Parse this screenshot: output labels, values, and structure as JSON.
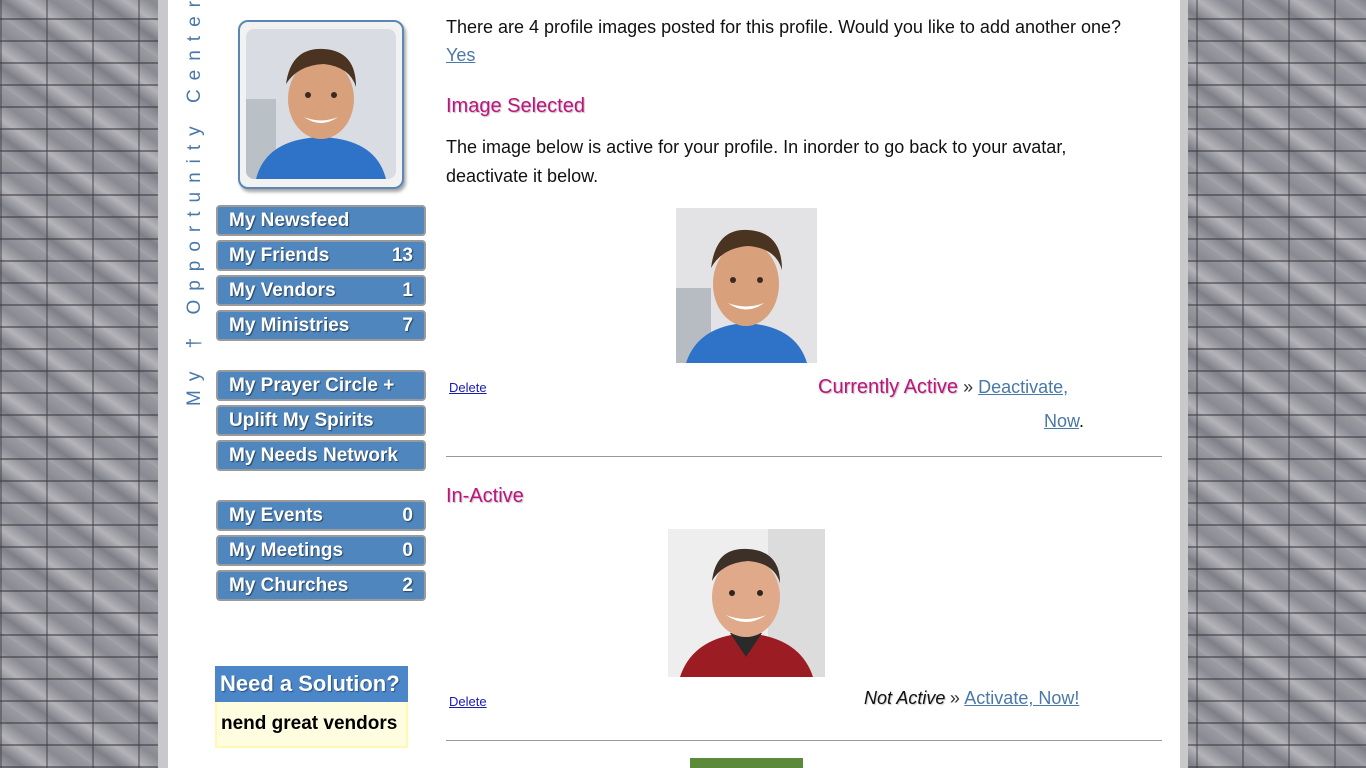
{
  "brand": {
    "vertical_text": "My † Opportunity Center™"
  },
  "menu": {
    "group1": [
      {
        "label": "My Newsfeed",
        "count": ""
      },
      {
        "label": "My Friends",
        "count": "13"
      },
      {
        "label": "My Vendors",
        "count": "1"
      },
      {
        "label": "My Ministries",
        "count": "7"
      }
    ],
    "group2": [
      {
        "label": "My Prayer Circle +",
        "count": ""
      },
      {
        "label": "Uplift My Spirits",
        "count": ""
      },
      {
        "label": "My Needs Network",
        "count": ""
      }
    ],
    "group3": [
      {
        "label": "My Events",
        "count": "0"
      },
      {
        "label": "My Meetings",
        "count": "0"
      },
      {
        "label": "My Churches",
        "count": "2"
      }
    ]
  },
  "need_box": {
    "title": "Need a Solution?",
    "body": "nend great vendors"
  },
  "main": {
    "intro": "There are 4 profile images posted for this profile. Would you like to add another one?",
    "yes_link": "Yes",
    "selected_heading": "Image Selected",
    "selected_desc": "The image below is active for your profile. In inorder to go back to your avatar, deactivate it below.",
    "delete_label": "Delete",
    "currently_active": "Currently Active",
    "separator": "»",
    "deactivate_link": "Deactivate,",
    "now_link": "Now",
    "period": ".",
    "inactive_heading": "In-Active",
    "delete_label_2": "Delete",
    "not_active": "Not Active",
    "activate_link": "Activate, Now!"
  },
  "colors": {
    "accent_pink": "#c0127e",
    "menu_blue": "#4f86bd",
    "link_blue": "#4a78a8"
  }
}
